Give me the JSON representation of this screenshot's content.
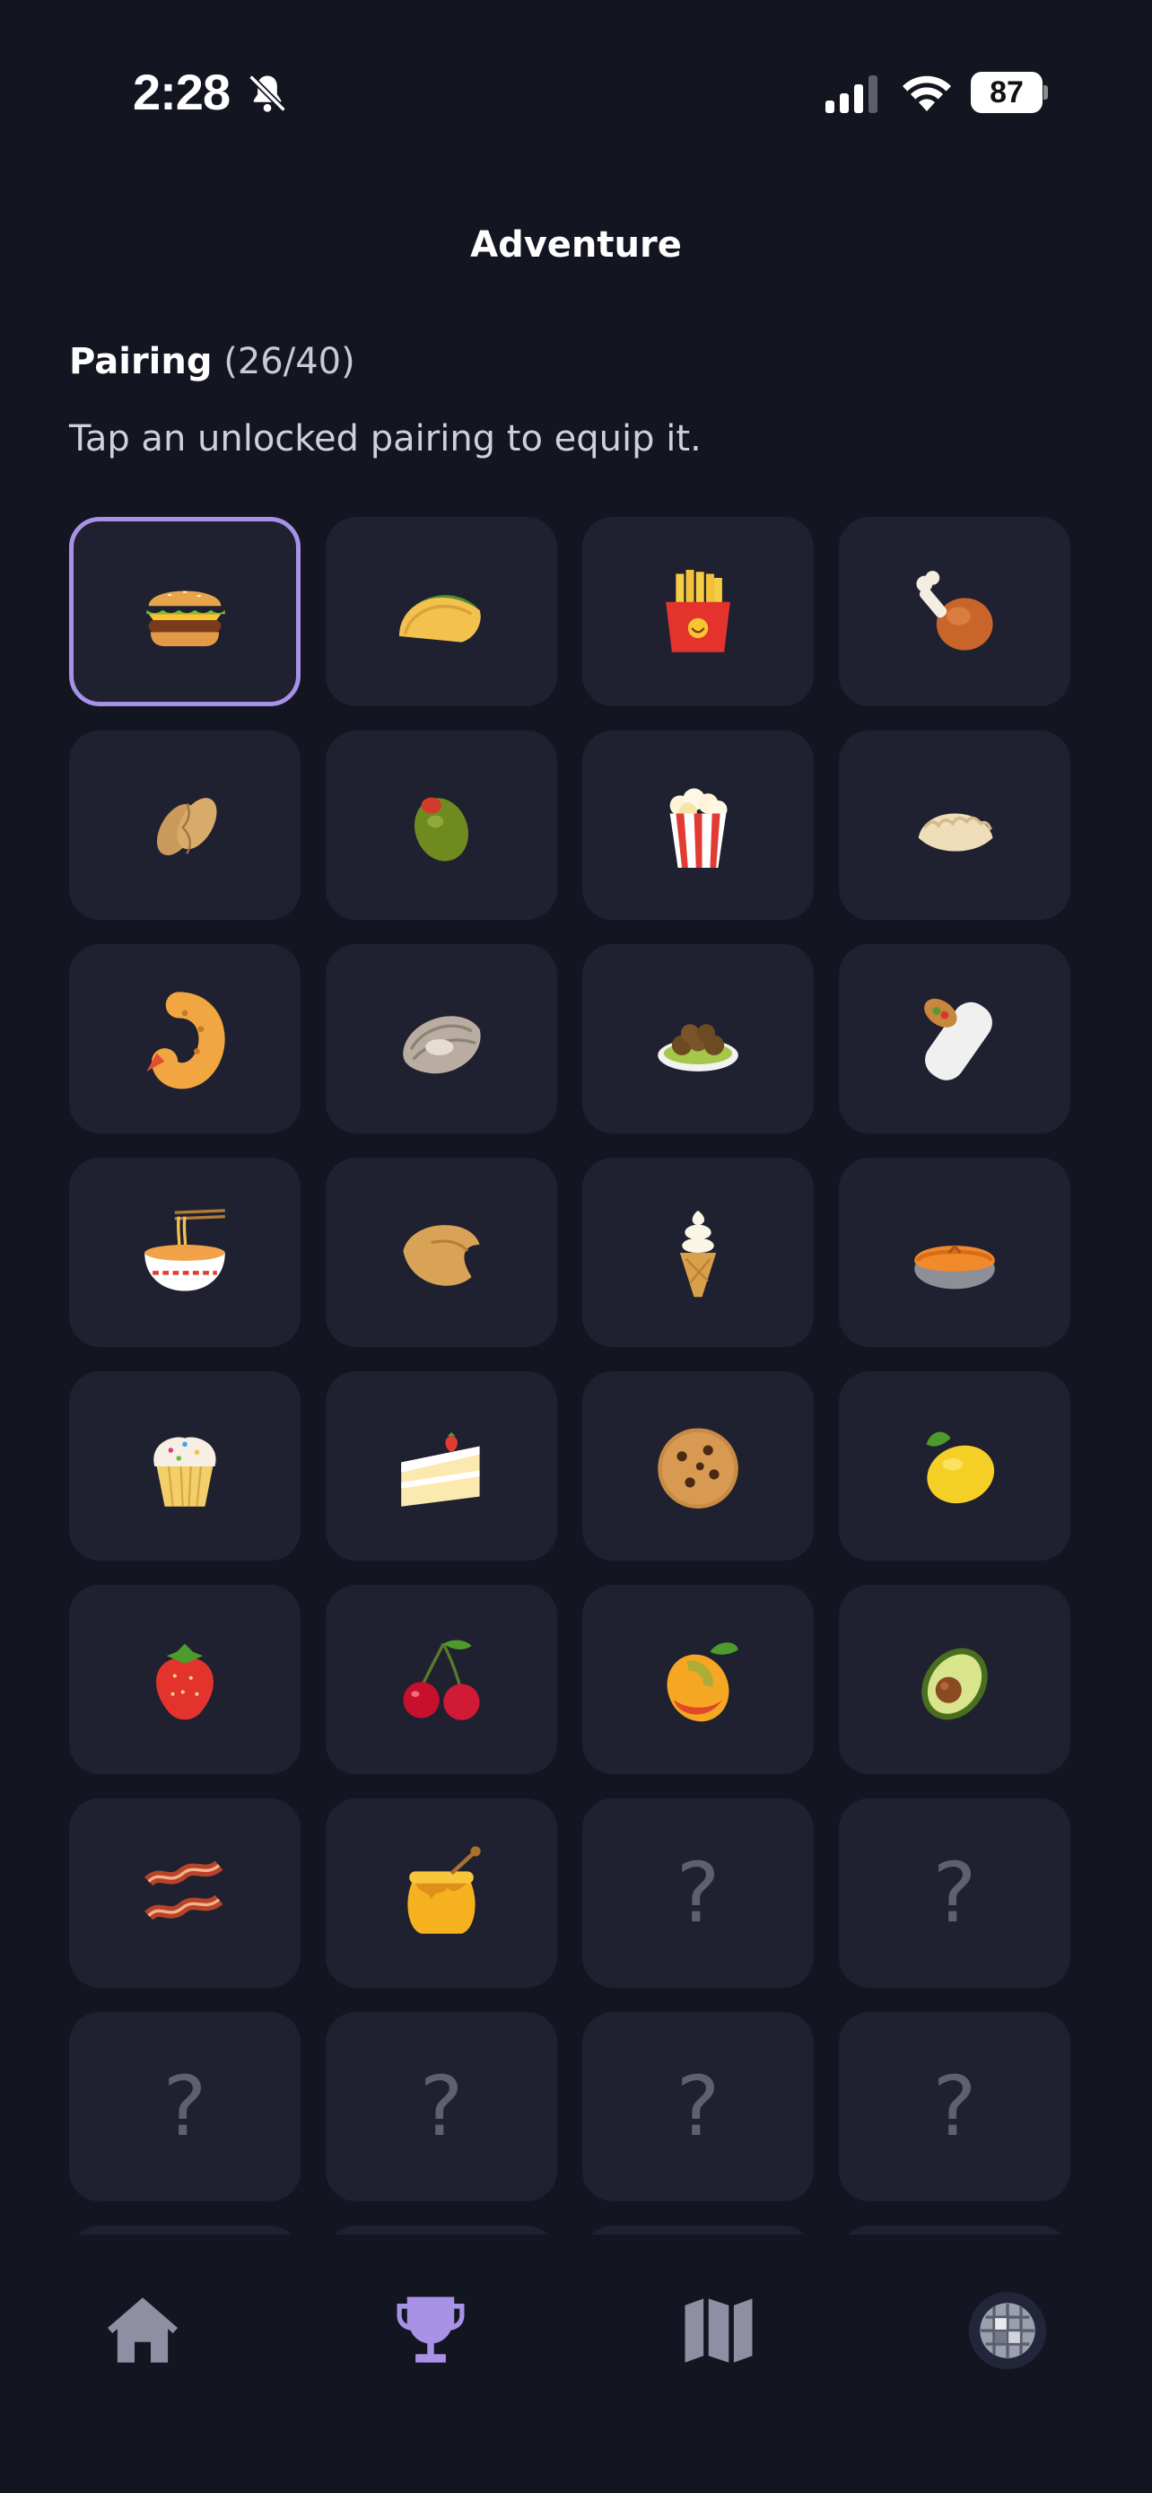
{
  "status": {
    "time": "2:28",
    "battery": "87"
  },
  "header": {
    "title": "Adventure"
  },
  "section": {
    "title": "Pairing",
    "count": "(26/40)",
    "hint": "Tap an unlocked pairing to equip it."
  },
  "tiles": [
    {
      "item": "hamburger",
      "state": "selected"
    },
    {
      "item": "taco",
      "state": "unlocked"
    },
    {
      "item": "french-fries",
      "state": "unlocked"
    },
    {
      "item": "poultry-leg",
      "state": "unlocked"
    },
    {
      "item": "peanuts",
      "state": "unlocked"
    },
    {
      "item": "olive",
      "state": "unlocked"
    },
    {
      "item": "popcorn",
      "state": "unlocked"
    },
    {
      "item": "dumpling",
      "state": "unlocked"
    },
    {
      "item": "fried-shrimp",
      "state": "unlocked"
    },
    {
      "item": "oyster",
      "state": "unlocked"
    },
    {
      "item": "falafel",
      "state": "unlocked"
    },
    {
      "item": "burrito",
      "state": "unlocked"
    },
    {
      "item": "noodle-bowl",
      "state": "unlocked"
    },
    {
      "item": "fortune-cookie",
      "state": "unlocked"
    },
    {
      "item": "soft-ice-cream",
      "state": "unlocked"
    },
    {
      "item": "pie",
      "state": "unlocked"
    },
    {
      "item": "cupcake",
      "state": "unlocked"
    },
    {
      "item": "shortcake",
      "state": "unlocked"
    },
    {
      "item": "cookie",
      "state": "unlocked"
    },
    {
      "item": "lemon",
      "state": "unlocked"
    },
    {
      "item": "strawberry",
      "state": "unlocked"
    },
    {
      "item": "cherries",
      "state": "unlocked"
    },
    {
      "item": "mango",
      "state": "unlocked"
    },
    {
      "item": "avocado",
      "state": "unlocked"
    },
    {
      "item": "bacon",
      "state": "unlocked"
    },
    {
      "item": "honey-pot",
      "state": "unlocked"
    },
    {
      "item": "locked",
      "state": "locked",
      "label": "?"
    },
    {
      "item": "locked",
      "state": "locked",
      "label": "?"
    },
    {
      "item": "locked",
      "state": "locked",
      "label": "?"
    },
    {
      "item": "locked",
      "state": "locked",
      "label": "?"
    },
    {
      "item": "locked",
      "state": "locked",
      "label": "?"
    },
    {
      "item": "locked",
      "state": "locked",
      "label": "?"
    },
    {
      "item": "locked",
      "state": "locked",
      "label": "?"
    },
    {
      "item": "locked",
      "state": "locked",
      "label": "?"
    },
    {
      "item": "locked",
      "state": "locked",
      "label": "?"
    },
    {
      "item": "locked",
      "state": "locked",
      "label": "?"
    }
  ],
  "tabs": [
    {
      "name": "home-icon",
      "active": false
    },
    {
      "name": "trophy-icon",
      "active": true
    },
    {
      "name": "map-icon",
      "active": false
    },
    {
      "name": "disco-ball-icon",
      "active": false
    }
  ],
  "colors": {
    "background": "#131521",
    "tile": "#1f2130",
    "accent": "#a792e6",
    "inactive_tab": "#8e8fa3"
  }
}
